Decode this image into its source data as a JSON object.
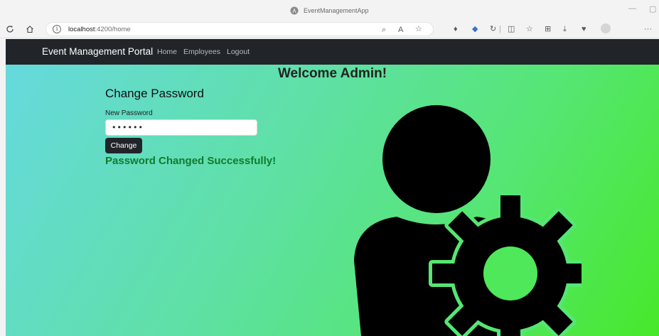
{
  "browser": {
    "window_title": "EventManagementApp",
    "url_host": "localhost",
    "url_rest": ":4200/home"
  },
  "navbar": {
    "brand": "Event Management Portal",
    "links": [
      {
        "label": "Home"
      },
      {
        "label": "Employees"
      },
      {
        "label": "Logout"
      }
    ]
  },
  "main": {
    "welcome": "Welcome Admin!",
    "form_title": "Change Password",
    "new_password_label": "New Password",
    "password_value": "••••••",
    "change_button": "Change",
    "success_message": "Password Changed Successfully!"
  },
  "colors": {
    "navbar_bg": "#212529",
    "success_text": "#127a2c",
    "gradient_start": "#66d9dd",
    "gradient_end": "#47e82a"
  },
  "icons": [
    "refresh-icon",
    "home-icon",
    "info-icon",
    "admin-settings-icon"
  ]
}
